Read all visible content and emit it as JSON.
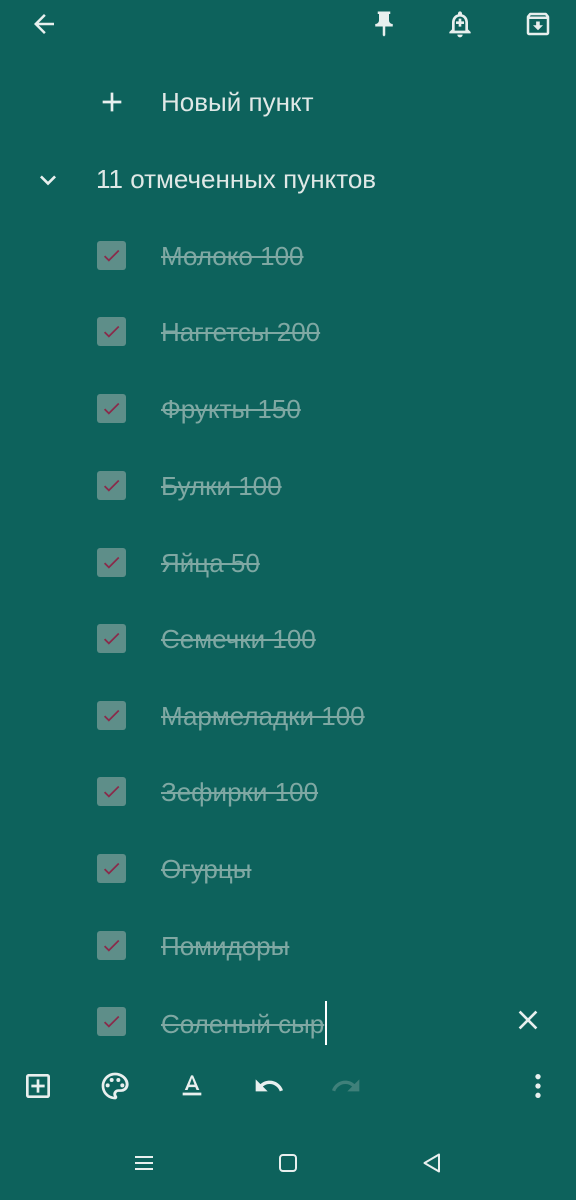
{
  "topbar": {
    "icons": [
      "back-arrow-icon",
      "pin-icon",
      "add-reminder-icon",
      "archive-icon"
    ]
  },
  "list": {
    "new_item_label": "Новый пункт",
    "checked_header": "11 отмеченных пунктов",
    "checked_items": [
      {
        "text": "Молоко 100",
        "checked": true
      },
      {
        "text": "Наггетсы 200",
        "checked": true
      },
      {
        "text": "Фрукты 150",
        "checked": true
      },
      {
        "text": "Булки 100",
        "checked": true
      },
      {
        "text": "Яйца 50",
        "checked": true
      },
      {
        "text": "Семечки 100",
        "checked": true
      },
      {
        "text": "Мармеладки 100",
        "checked": true
      },
      {
        "text": "Зефирки 100",
        "checked": true
      },
      {
        "text": "Огурцы",
        "checked": true
      },
      {
        "text": "Помидоры",
        "checked": true
      },
      {
        "text": "Соленый сыр",
        "checked": true
      }
    ]
  },
  "bottom_toolbar": {
    "icons": [
      "add-box-icon",
      "palette-icon",
      "text-format-icon",
      "undo-icon",
      "redo-icon",
      "more-vert-icon"
    ]
  },
  "navbar": {
    "icons": [
      "recent-apps-icon",
      "home-icon",
      "back-icon"
    ]
  },
  "colors": {
    "background": "#0d625c",
    "checkbox_fill": "#5e8e89",
    "checkmark": "#8a2a4a",
    "checked_text": "#7fa8a3",
    "primary_text": "#dfe8e6"
  }
}
